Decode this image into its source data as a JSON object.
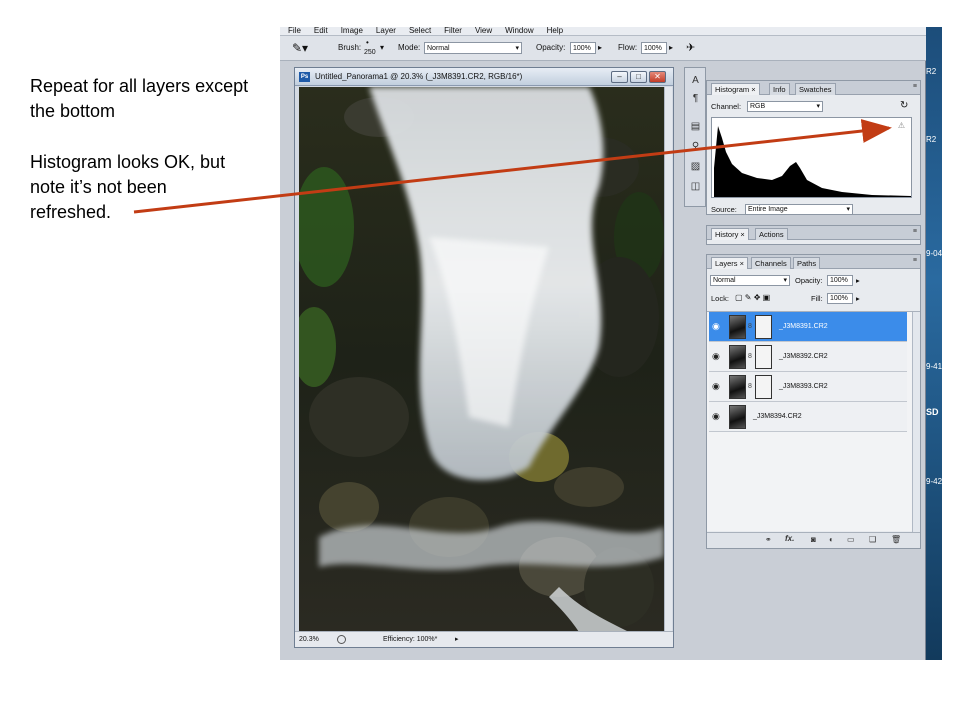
{
  "annotation": {
    "line1": "Repeat for all layers except the bottom",
    "line2": "Histogram looks OK, but note it’s not been refreshed.",
    "arrow_color": "#c23c14"
  },
  "menu": [
    "File",
    "Edit",
    "Image",
    "Layer",
    "Select",
    "Filter",
    "View",
    "Window",
    "Help"
  ],
  "options_bar": {
    "brush_label": "Brush:",
    "brush_size": "250",
    "mode_label": "Mode:",
    "mode_value": "Normal",
    "opacity_label": "Opacity:",
    "opacity_value": "100%",
    "flow_label": "Flow:",
    "flow_value": "100%"
  },
  "document": {
    "title": "Untitled_Panorama1 @ 20.3% (_J3M8391.CR2, RGB/16*)",
    "zoom": "20.3%",
    "status": "Efficiency: 100%*",
    "app_icon": "Ps"
  },
  "histogram_panel": {
    "tabs": [
      "Histogram",
      "Info",
      "Swatches"
    ],
    "channel_label": "Channel:",
    "channel_value": "RGB",
    "source_label": "Source:",
    "source_value": "Entire Image",
    "warning_icon": "warning-icon"
  },
  "history_panel": {
    "tabs": [
      "History",
      "Actions"
    ]
  },
  "layers_panel": {
    "tabs": [
      "Layers",
      "Channels",
      "Paths"
    ],
    "blend_mode": "Normal",
    "opacity_label": "Opacity:",
    "opacity_value": "100%",
    "lock_label": "Lock:",
    "fill_label": "Fill:",
    "fill_value": "100%",
    "layers": [
      {
        "name": "_J3M8391.CR2",
        "selected": true,
        "has_mask": true
      },
      {
        "name": "_J3M8392.CR2",
        "selected": false,
        "has_mask": true
      },
      {
        "name": "_J3M8393.CR2",
        "selected": false,
        "has_mask": true
      },
      {
        "name": "_J3M8394.CR2",
        "selected": false,
        "has_mask": false
      }
    ],
    "footer_icons": [
      "link-icon",
      "fx-icon",
      "mask-icon",
      "adjustment-icon",
      "group-icon",
      "new-layer-icon",
      "trash-icon"
    ],
    "fx_label": "fx."
  },
  "right_strip": [
    "R2",
    "R2",
    "9-04",
    "9-41",
    "SD",
    "9-42"
  ],
  "colors": {
    "selected_layer": "#3b8cea",
    "desktop": "#4e7da6"
  }
}
